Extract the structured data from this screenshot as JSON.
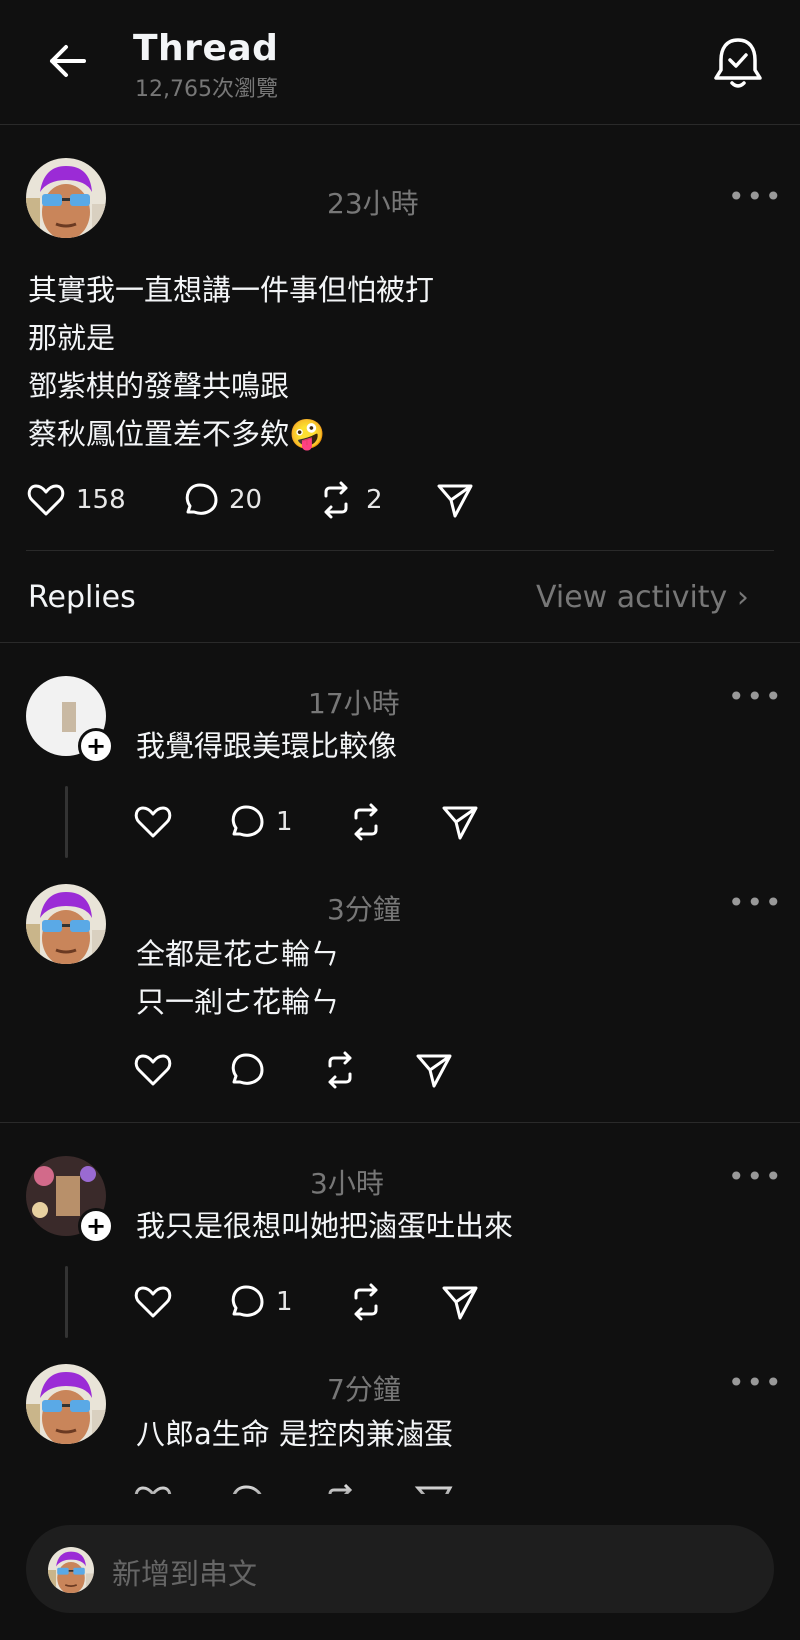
{
  "header": {
    "title": "Thread",
    "views": "12,765次瀏覽",
    "back_icon": "arrow-left-icon",
    "bell_icon": "bell-check-icon"
  },
  "post": {
    "time": "23小時",
    "text": "其實我一直想講一件事但怕被打\n那就是\n鄧紫棋的發聲共鳴跟\n蔡秋鳳位置差不多欸🤪",
    "likes": "158",
    "replies": "20",
    "reposts": "2"
  },
  "replies_bar": {
    "label": "Replies",
    "view_activity": "View activity"
  },
  "replies": [
    {
      "time": "17小時",
      "text": "我覺得跟美環比較像",
      "replies": "1"
    },
    {
      "time": "3分鐘",
      "text": "全都是花ㄜ輪ㄣ\n只一剎ㄜ花輪ㄣ",
      "replies": ""
    },
    {
      "time": "3小時",
      "text": "我只是很想叫她把滷蛋吐出來",
      "replies": "1"
    },
    {
      "time": "7分鐘",
      "text": "八郎a生命 是控肉兼滷蛋",
      "replies": ""
    }
  ],
  "composer": {
    "placeholder": "新增到串文"
  },
  "colors": {
    "background": "#101010",
    "text": "#f3f5f7",
    "muted": "#777777",
    "divider": "#2a2a2a"
  }
}
